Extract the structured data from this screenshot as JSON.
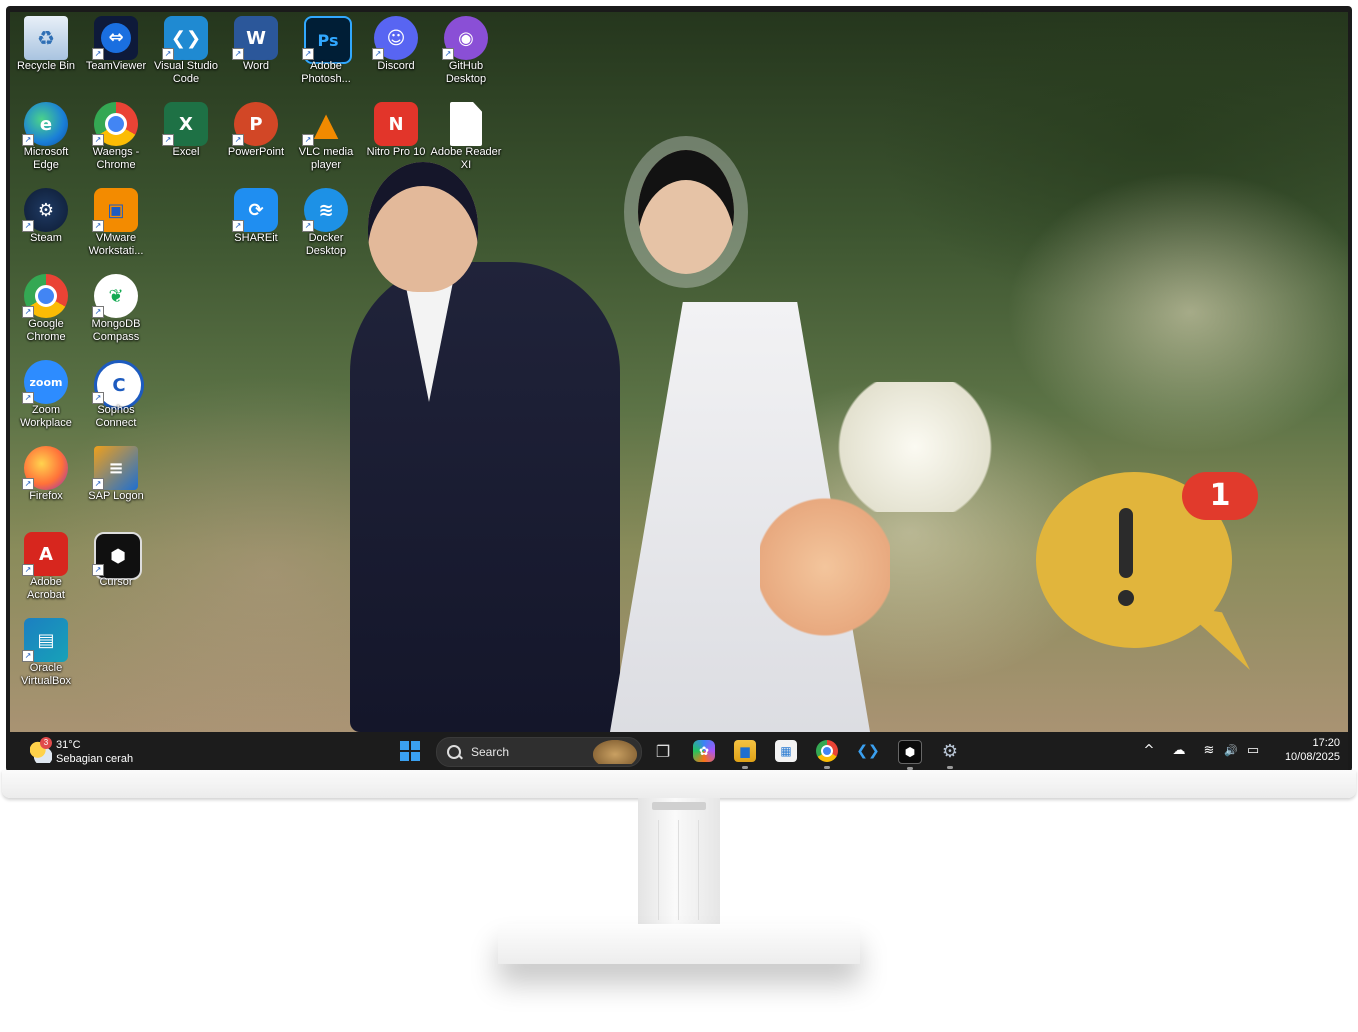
{
  "desktop": {
    "icons": [
      {
        "label": "Recycle Bin",
        "icon": "recycle-bin-icon"
      },
      {
        "label": "TeamViewer",
        "icon": "teamviewer-icon"
      },
      {
        "label": "Visual Studio Code",
        "icon": "vscode-icon"
      },
      {
        "label": "Word",
        "icon": "word-icon"
      },
      {
        "label": "Adobe Photosh...",
        "icon": "photoshop-icon"
      },
      {
        "label": "Discord",
        "icon": "discord-icon"
      },
      {
        "label": "GitHub Desktop",
        "icon": "github-icon"
      },
      {
        "label": "Microsoft Edge",
        "icon": "edge-icon"
      },
      {
        "label": "Waengs - Chrome",
        "icon": "chrome-profile-icon"
      },
      {
        "label": "Excel",
        "icon": "excel-icon"
      },
      {
        "label": "PowerPoint",
        "icon": "powerpoint-icon"
      },
      {
        "label": "VLC media player",
        "icon": "vlc-icon"
      },
      {
        "label": "Nitro Pro 10",
        "icon": "nitro-icon"
      },
      {
        "label": "Adobe Reader XI",
        "icon": "file-icon"
      },
      {
        "label": "Steam",
        "icon": "steam-icon"
      },
      {
        "label": "VMware Workstati...",
        "icon": "vmware-icon"
      },
      {
        "label": "SHAREit",
        "icon": "shareit-icon"
      },
      {
        "label": "Docker Desktop",
        "icon": "docker-icon"
      },
      {
        "label": "Google Chrome",
        "icon": "chrome-icon"
      },
      {
        "label": "MongoDB Compass",
        "icon": "mongodb-icon"
      },
      {
        "label": "Zoom Workplace",
        "icon": "zoom-icon"
      },
      {
        "label": "Sophos Connect",
        "icon": "sophos-icon"
      },
      {
        "label": "Firefox",
        "icon": "firefox-icon"
      },
      {
        "label": "SAP Logon",
        "icon": "sap-icon"
      },
      {
        "label": "Adobe Acrobat",
        "icon": "acrobat-icon"
      },
      {
        "label": "Cursor",
        "icon": "cursor-icon"
      },
      {
        "label": "Oracle VirtualBox",
        "icon": "virtualbox-icon"
      }
    ],
    "glyphs": {
      "teamviewer": "⇔",
      "vscode": "❮❯",
      "word": "W",
      "photoshop": "Ps",
      "discord": "☺",
      "github": "◉",
      "edge": "e",
      "excel": "X",
      "powerpoint": "P",
      "vlc": "▲",
      "nitro": "N",
      "steam": "⚙",
      "vmware": "▣",
      "shareit": "⟳",
      "docker": "≋",
      "mongodb": "❦",
      "zoom": "zoom",
      "sophos": "C",
      "sap": "≡",
      "acrobat": "A",
      "cursor": "⬢",
      "virtualbox": "▤",
      "shortcut": "↗"
    }
  },
  "notification": {
    "count": "1",
    "mark": "!"
  },
  "taskbar": {
    "weather": {
      "badge": "3",
      "temperature": "31°C",
      "condition": "Sebagian cerah"
    },
    "search": {
      "label": "Search"
    },
    "apps": [
      {
        "name": "task-view",
        "glyph": "❐"
      },
      {
        "name": "copilot",
        "glyph": "✿"
      },
      {
        "name": "file-explorer",
        "glyph": "▆"
      },
      {
        "name": "microsoft-store",
        "glyph": "▦"
      },
      {
        "name": "chrome",
        "glyph": "◍"
      },
      {
        "name": "vscode",
        "glyph": "❮❯"
      },
      {
        "name": "cursor",
        "glyph": "⬢"
      },
      {
        "name": "settings",
        "glyph": "⚙"
      }
    ],
    "tray": {
      "chevron": "^",
      "cloud": "☁",
      "wifi": "≋",
      "volume": "🔊",
      "battery": "▭"
    },
    "clock": {
      "time": "17:20",
      "date": "10/08/2025"
    }
  },
  "colors": {
    "taskbar_bg": "#1c1c1c",
    "notify_yellow": "#e1b53c",
    "notify_red": "#e13a2c",
    "accent_blue": "#3aa0f0"
  }
}
